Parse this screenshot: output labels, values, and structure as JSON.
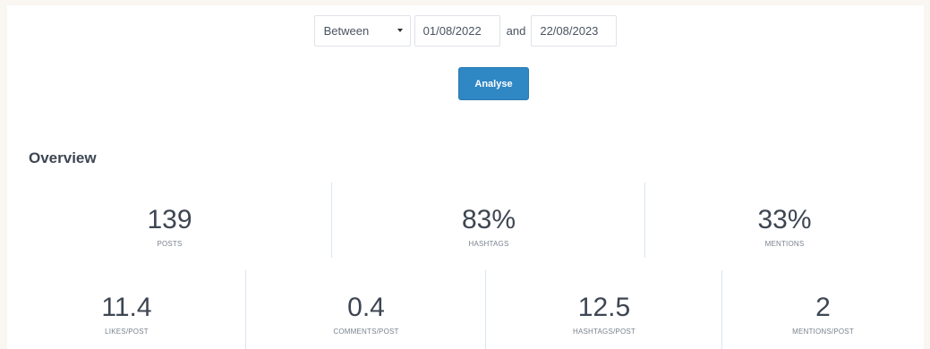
{
  "filter": {
    "mode_selected": "Between",
    "start_date": "01/08/2022",
    "joiner": "and",
    "end_date": "22/08/2023",
    "analyse_label": "Analyse"
  },
  "overview": {
    "title": "Overview",
    "row1": [
      {
        "value": "139",
        "label": "POSTS"
      },
      {
        "value": "83%",
        "label": "HASHTAGS"
      },
      {
        "value": "33%",
        "label": "MENTIONS"
      }
    ],
    "row2": [
      {
        "value": "11.4",
        "label": "LIKES/POST"
      },
      {
        "value": "0.4",
        "label": "COMMENTS/POST"
      },
      {
        "value": "12.5",
        "label": "HASHTAGS/POST"
      },
      {
        "value": "2",
        "label": "MENTIONS/POST"
      }
    ]
  },
  "colors": {
    "page_background": "#faf6f1",
    "button_accent": "#2f87c4",
    "divider": "#dbe4ee"
  },
  "icons": {
    "select_caret": "caret-down-icon"
  }
}
